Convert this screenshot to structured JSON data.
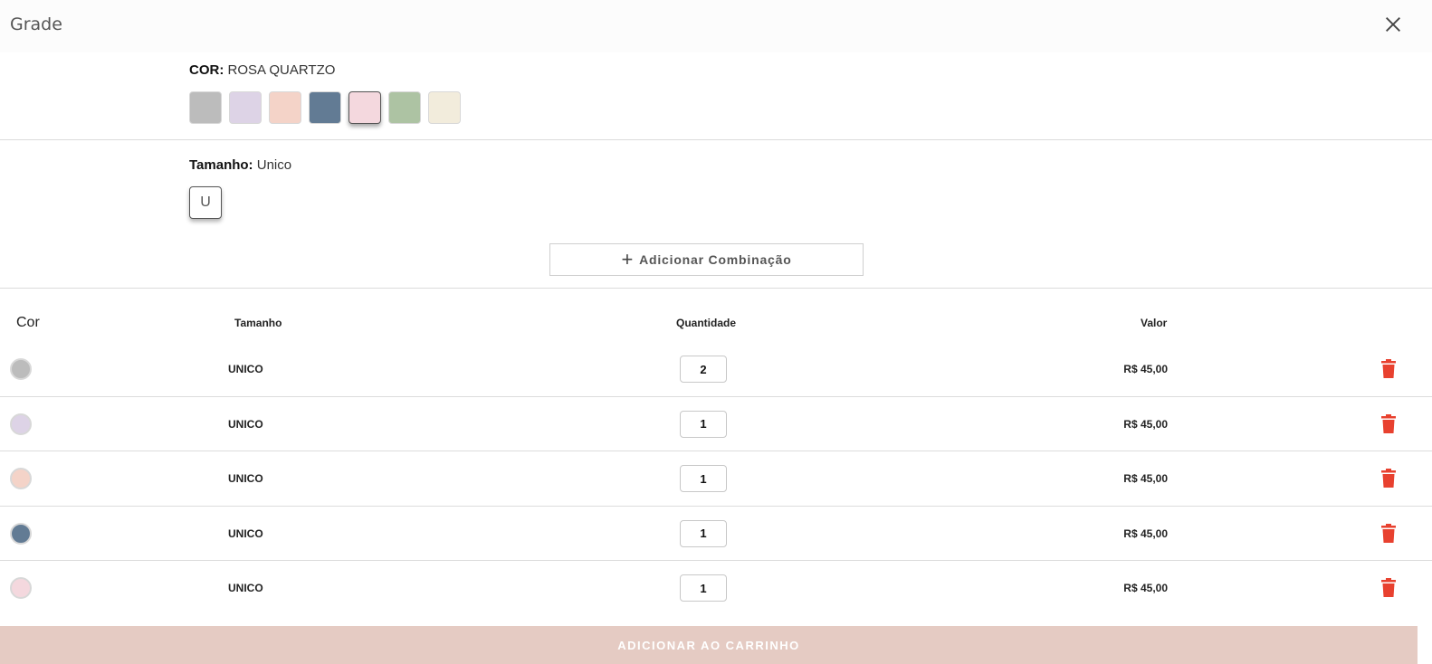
{
  "header": {
    "title": "Grade"
  },
  "color": {
    "label": "COR:",
    "value": "ROSA QUARTZO",
    "swatches": [
      {
        "color": "#bcbcbc",
        "selected": false
      },
      {
        "color": "#ddd3e6",
        "selected": false
      },
      {
        "color": "#f4d3c8",
        "selected": false
      },
      {
        "color": "#627b94",
        "selected": false
      },
      {
        "color": "#f4d8de",
        "selected": true
      },
      {
        "color": "#adc3a3",
        "selected": false
      },
      {
        "color": "#f2ecdc",
        "selected": false
      }
    ]
  },
  "size": {
    "label": "Tamanho:",
    "value": "Unico",
    "chip": "U"
  },
  "add_combo": {
    "icon": "plus-icon",
    "label": "Adicionar Combinação"
  },
  "table": {
    "headers": {
      "cor": "Cor",
      "tamanho": "Tamanho",
      "quantidade": "Quantidade",
      "valor": "Valor"
    },
    "rows": [
      {
        "color": "#bcbcbc",
        "size": "UNICO",
        "qty": "2",
        "price": "R$ 45,00"
      },
      {
        "color": "#ddd3e6",
        "size": "UNICO",
        "qty": "1",
        "price": "R$ 45,00"
      },
      {
        "color": "#f4d3c8",
        "size": "UNICO",
        "qty": "1",
        "price": "R$ 45,00"
      },
      {
        "color": "#627b94",
        "size": "UNICO",
        "qty": "1",
        "price": "R$ 45,00"
      },
      {
        "color": "#f4d8de",
        "size": "UNICO",
        "qty": "1",
        "price": "R$ 45,00"
      }
    ]
  },
  "cart_button": {
    "label": "ADICIONAR AO CARRINHO",
    "bg": "#e5cbc3"
  },
  "colors": {
    "trash": "#e8412f"
  }
}
